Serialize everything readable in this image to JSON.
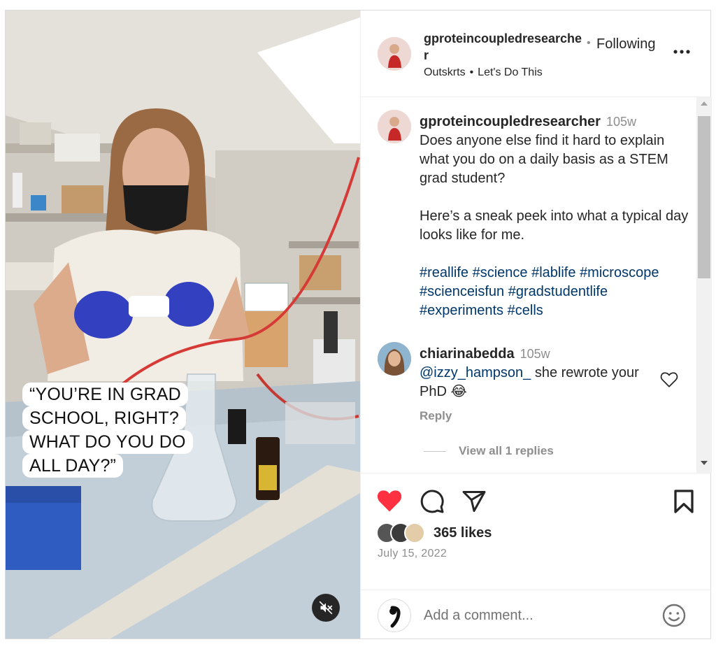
{
  "post": {
    "owner": {
      "username": "gproteincoupledresearcher",
      "follow_state": "Following",
      "audio_artist": "Outskrts",
      "audio_track": "Let's Do This"
    },
    "media": {
      "overlay_lines": [
        "“YOU’RE IN GRAD",
        "SCHOOL, RIGHT?",
        "WHAT DO YOU DO",
        "ALL DAY?”"
      ]
    },
    "caption": {
      "username": "gproteincoupledresearcher",
      "time": "105w",
      "paragraph1": "Does anyone else find it hard to explain what you do on a daily basis as a STEM grad student?",
      "paragraph2": "Here’s a sneak peek into what a typical day looks like for me.",
      "hashtags": [
        "#reallife",
        "#science",
        "#lablife",
        "#microscope",
        "#scienceisfun",
        "#gradstudentlife",
        "#experiments",
        "#cells"
      ]
    },
    "comments": [
      {
        "username": "chiarinabedda",
        "time": "105w",
        "mention": "@izzy_hampson_",
        "text": " she rewrote your PhD 😂",
        "reply_label": "Reply",
        "view_replies_label": "View all 1 replies"
      }
    ],
    "likes_label": "365 likes",
    "date": "July 15, 2022",
    "add_comment_placeholder": "Add a comment..."
  },
  "colors": {
    "like_red": "#ff3040",
    "link_blue": "#00376b",
    "muted_gray": "#8e8e8e"
  },
  "icons": {
    "like": "heart-filled-icon",
    "comment": "speech-bubble-icon",
    "share": "paper-plane-icon",
    "save": "bookmark-icon",
    "mute": "speaker-muted-icon",
    "emoji": "smiley-icon",
    "more": "ellipsis-icon"
  }
}
